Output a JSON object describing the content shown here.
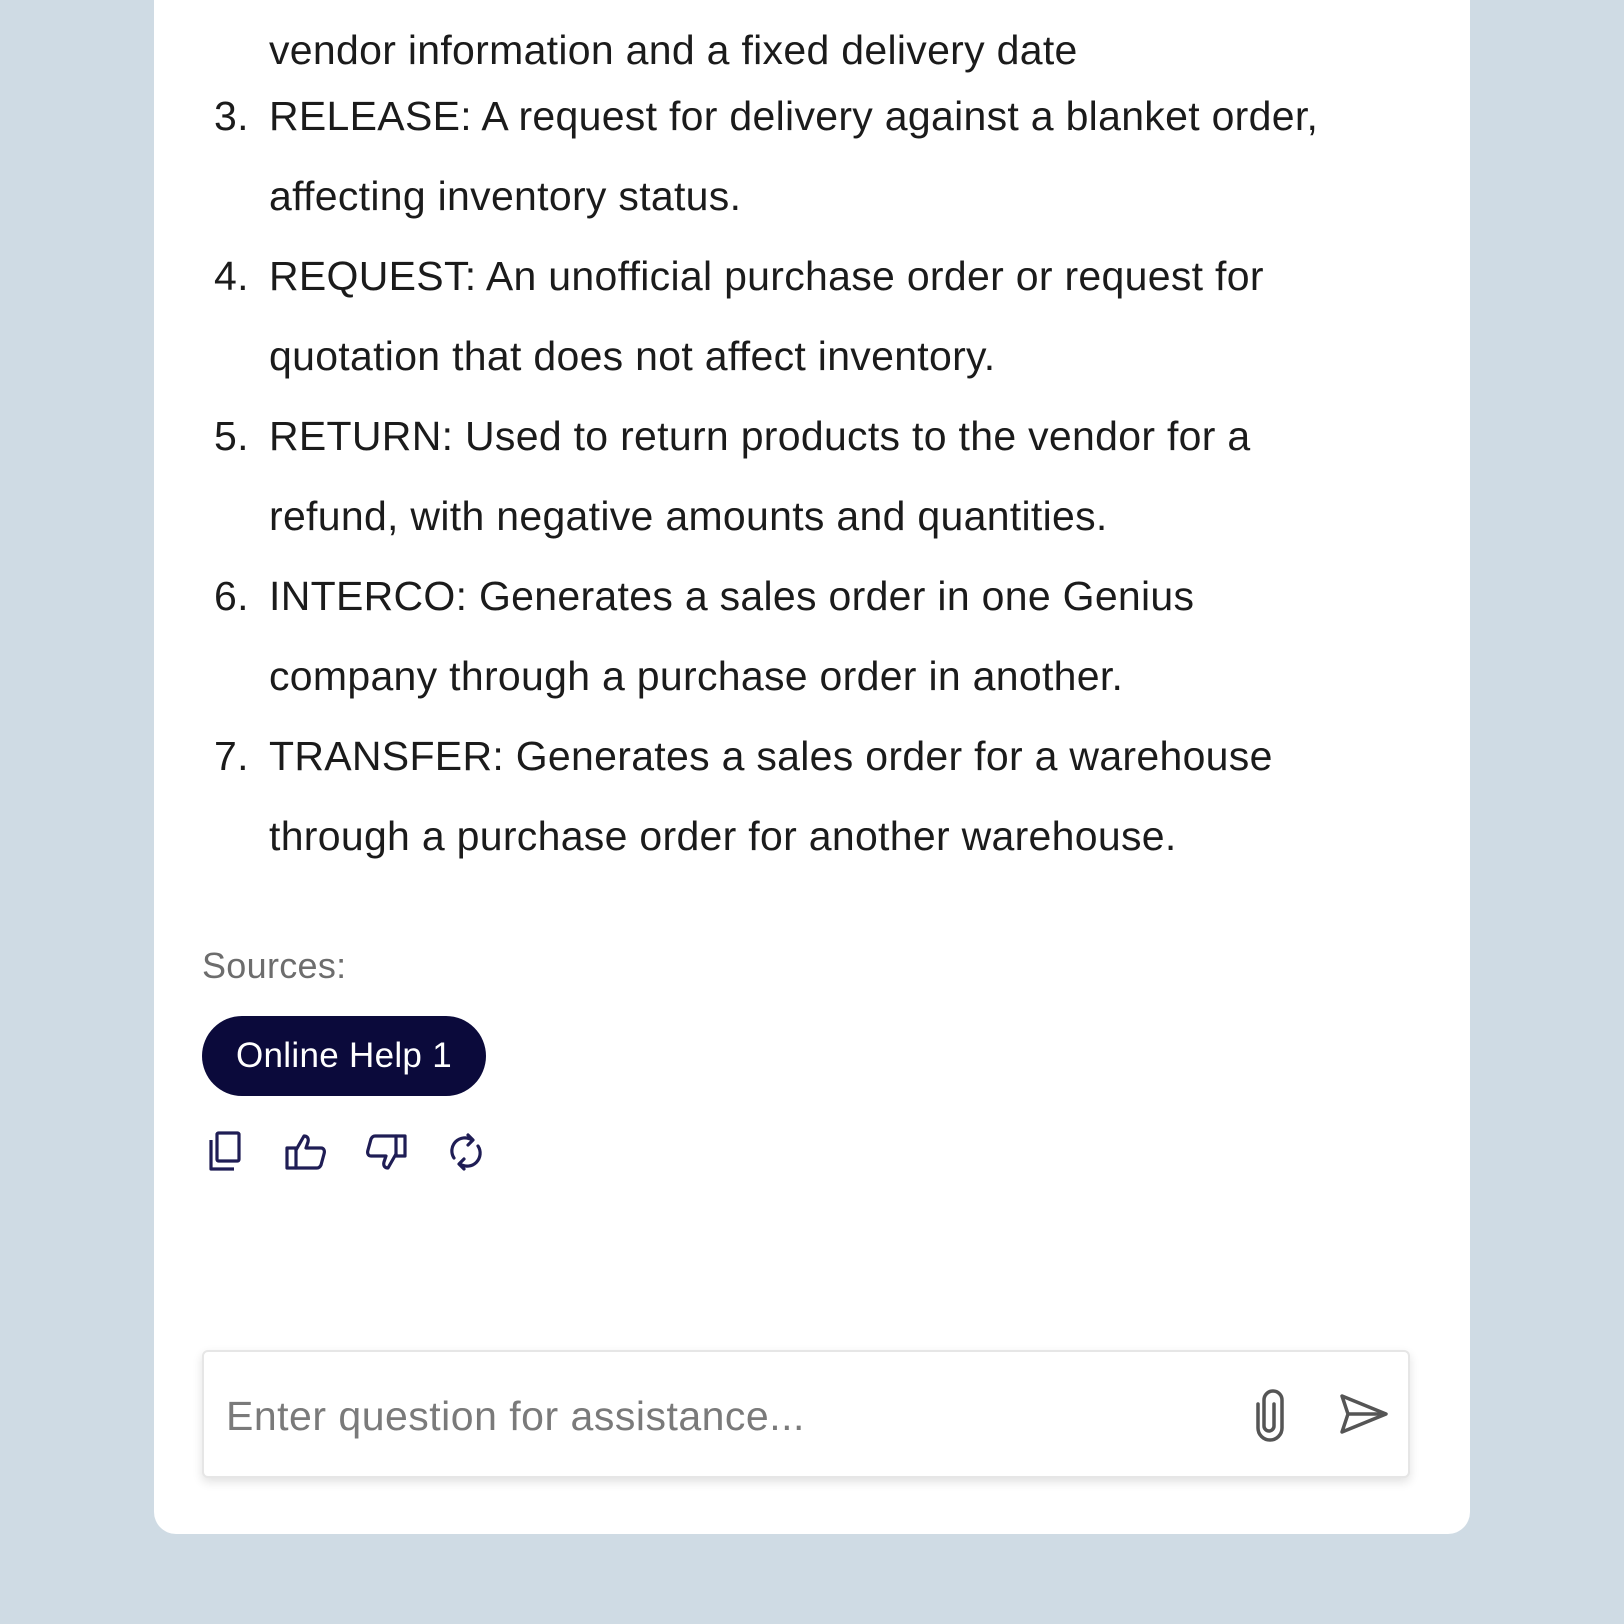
{
  "answer": {
    "continuation_line": "vendor information and a fixed delivery date",
    "items": [
      {
        "number": "3.",
        "line1": "RELEASE: A request for delivery against a blanket order,",
        "line2": "affecting inventory status."
      },
      {
        "number": "4.",
        "line1": "REQUEST: An unofficial purchase order or request for",
        "line2": "quotation that does not affect inventory."
      },
      {
        "number": "5.",
        "line1": "RETURN: Used to return products to the vendor for a",
        "line2": "refund, with negative amounts and quantities."
      },
      {
        "number": "6.",
        "line1": "INTERCO: Generates a sales order in one Genius",
        "line2": "company through a purchase order in another."
      },
      {
        "number": "7.",
        "line1": "TRANSFER: Generates a sales order for a warehouse",
        "line2": "through a purchase order for another warehouse."
      }
    ]
  },
  "sources": {
    "label": "Sources:",
    "chips": [
      "Online Help 1"
    ]
  },
  "actions": {
    "icons": [
      "copy-icon",
      "thumbs-up-icon",
      "thumbs-down-icon",
      "regenerate-icon"
    ]
  },
  "composer": {
    "placeholder": "Enter question for assistance...",
    "value": "",
    "attach_icon": "paperclip-icon",
    "send_icon": "send-icon"
  },
  "colors": {
    "page_background": "#cfdbe4",
    "panel_background": "#ffffff",
    "chip_background": "#0b0a3b",
    "icon_color": "#1f1d55",
    "text_color": "#1b1b1b",
    "muted_text": "#6d6d6d"
  }
}
